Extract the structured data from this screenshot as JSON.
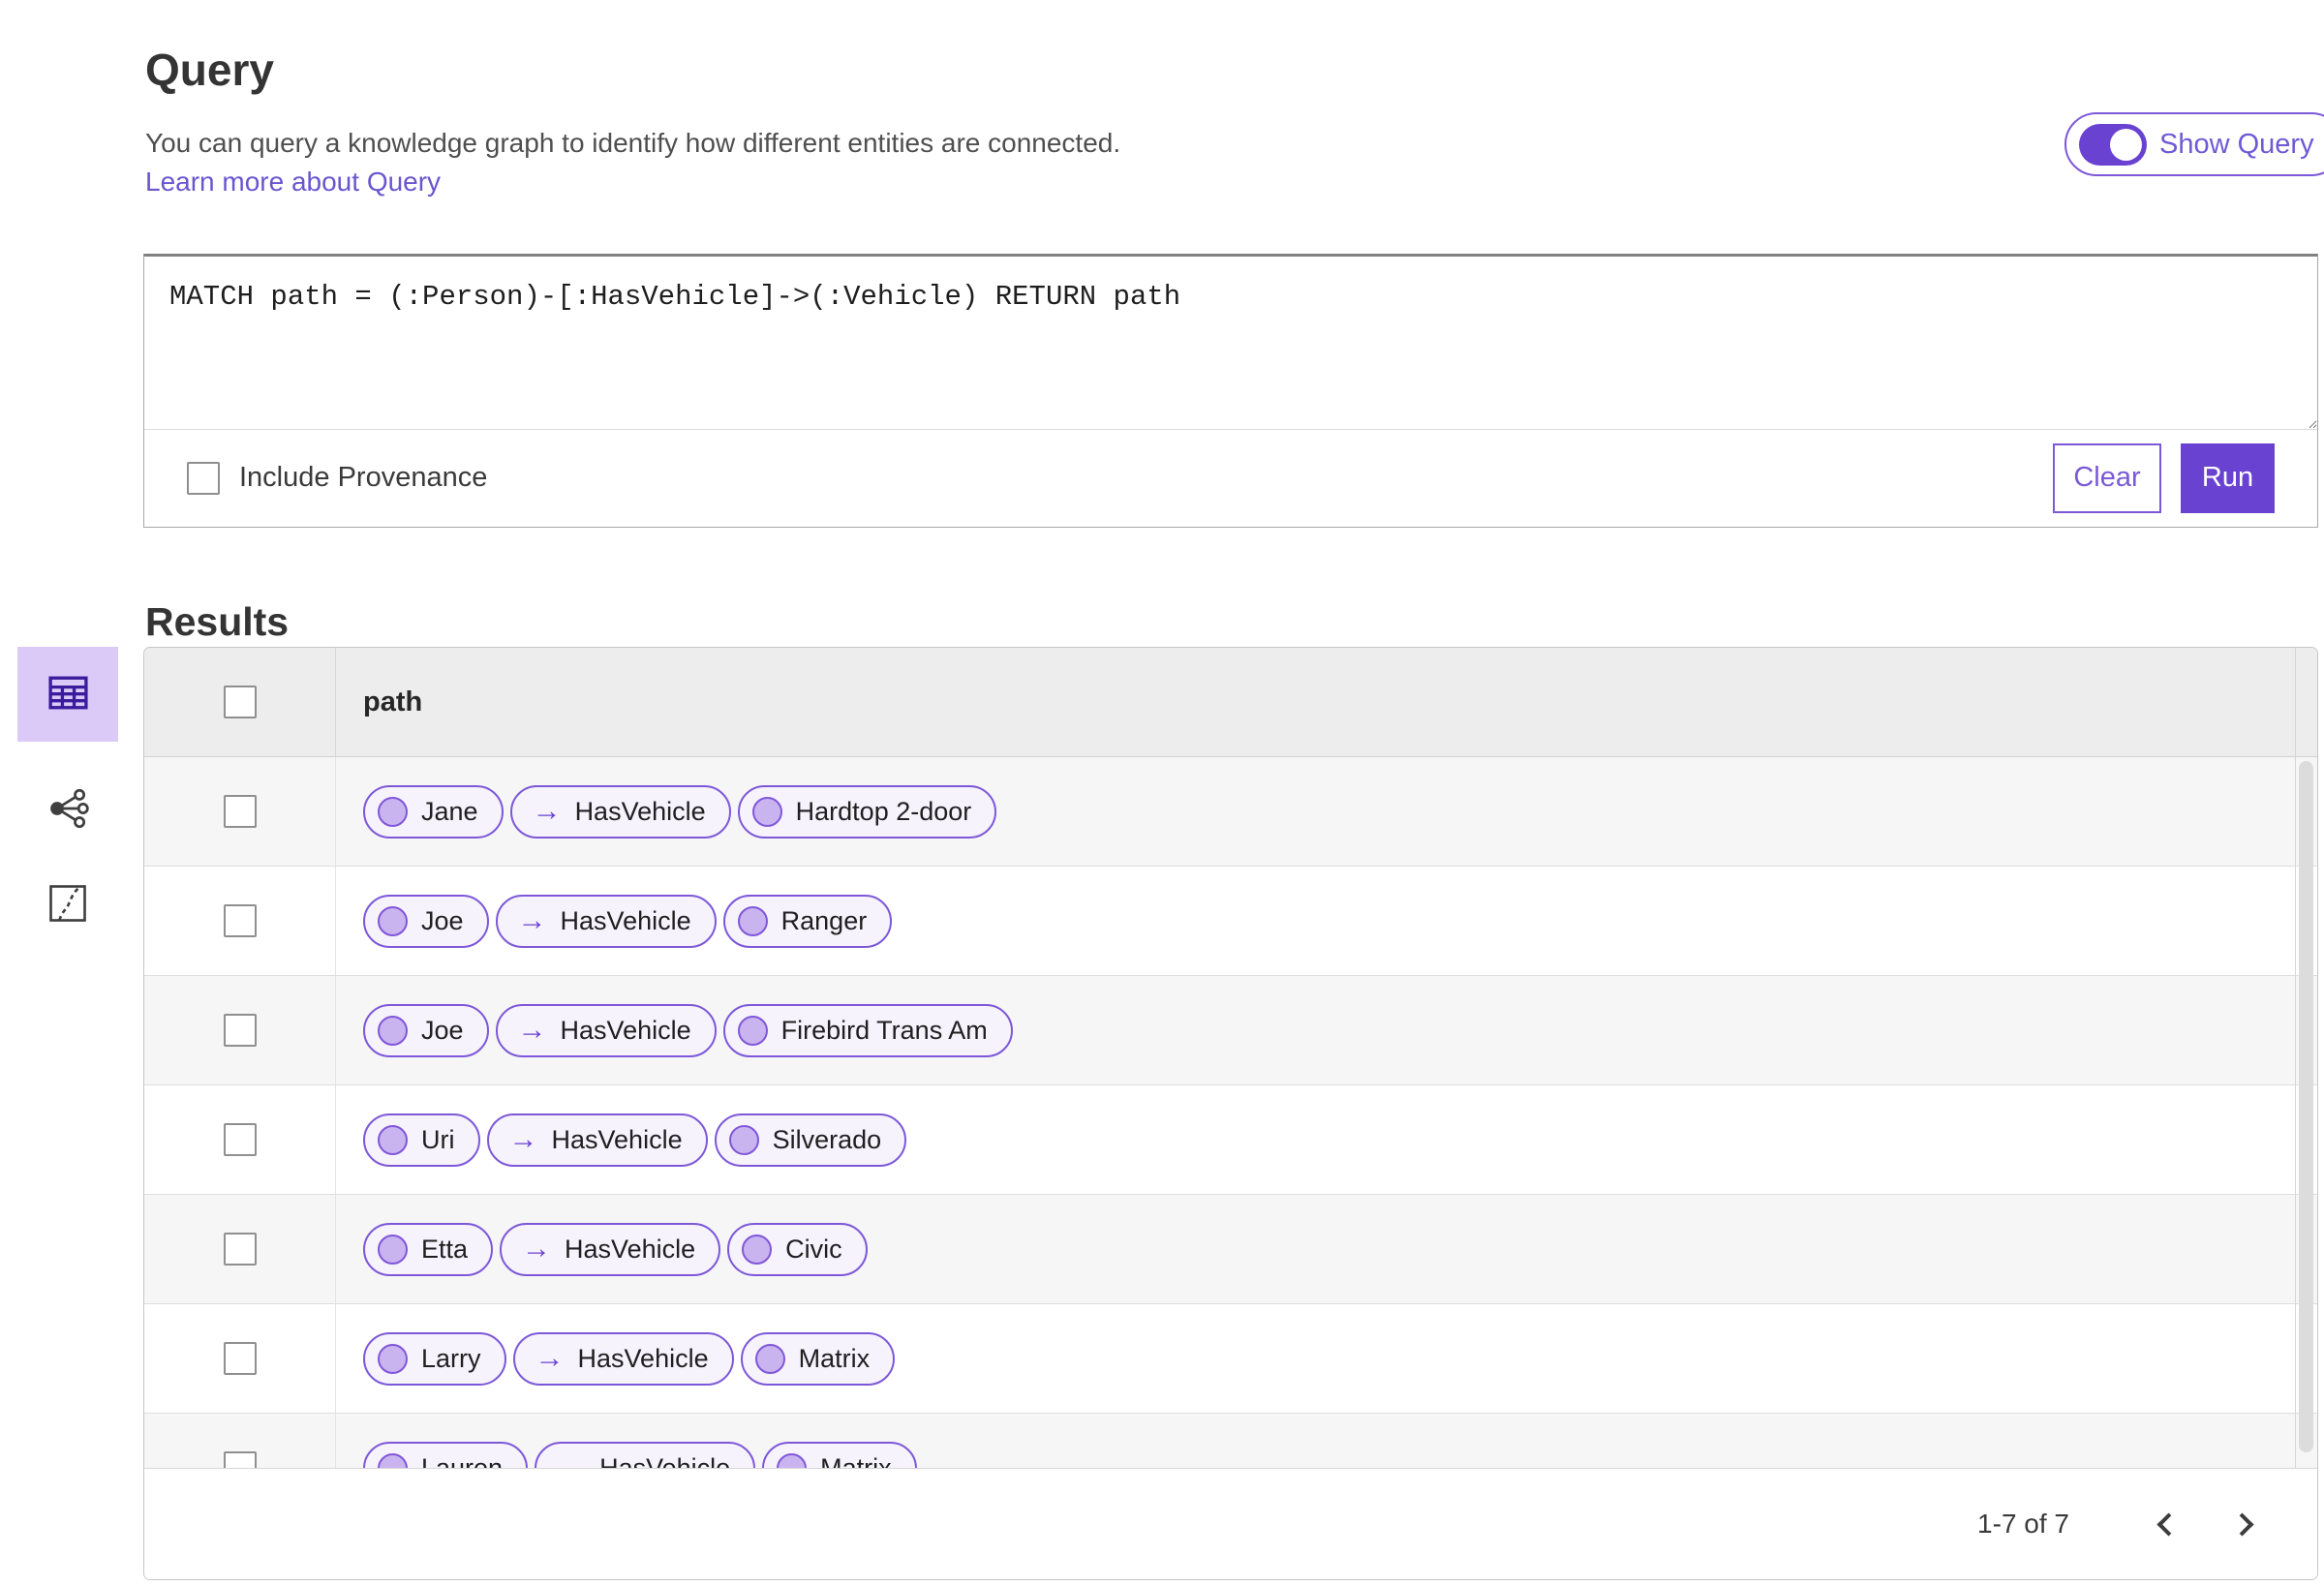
{
  "query_section": {
    "title": "Query",
    "description": "You can query a knowledge graph to identify how different entities are connected.",
    "learn_more_label": "Learn more about Query",
    "show_query_label": "Show Query",
    "show_query_on": true,
    "query_text": "MATCH path = (:Person)-[:HasVehicle]->(:Vehicle) RETURN path",
    "include_provenance_label": "Include Provenance",
    "include_provenance_checked": false,
    "clear_label": "Clear",
    "run_label": "Run"
  },
  "results_section": {
    "title": "Results",
    "view_switcher": [
      {
        "name": "table-view",
        "icon": "table-icon",
        "selected": true
      },
      {
        "name": "link-chart-view",
        "icon": "link-chart-icon",
        "selected": false
      },
      {
        "name": "map-view",
        "icon": "map-icon",
        "selected": false
      }
    ],
    "table": {
      "columns": [
        "path"
      ],
      "rows": [
        {
          "selected": false,
          "path": [
            {
              "type": "node",
              "label": "Jane"
            },
            {
              "type": "relationship",
              "label": "HasVehicle"
            },
            {
              "type": "node",
              "label": "Hardtop 2-door"
            }
          ]
        },
        {
          "selected": false,
          "path": [
            {
              "type": "node",
              "label": "Joe"
            },
            {
              "type": "relationship",
              "label": "HasVehicle"
            },
            {
              "type": "node",
              "label": "Ranger"
            }
          ]
        },
        {
          "selected": false,
          "path": [
            {
              "type": "node",
              "label": "Joe"
            },
            {
              "type": "relationship",
              "label": "HasVehicle"
            },
            {
              "type": "node",
              "label": "Firebird Trans Am"
            }
          ]
        },
        {
          "selected": false,
          "path": [
            {
              "type": "node",
              "label": "Uri"
            },
            {
              "type": "relationship",
              "label": "HasVehicle"
            },
            {
              "type": "node",
              "label": "Silverado"
            }
          ]
        },
        {
          "selected": false,
          "path": [
            {
              "type": "node",
              "label": "Etta"
            },
            {
              "type": "relationship",
              "label": "HasVehicle"
            },
            {
              "type": "node",
              "label": "Civic"
            }
          ]
        },
        {
          "selected": false,
          "path": [
            {
              "type": "node",
              "label": "Larry"
            },
            {
              "type": "relationship",
              "label": "HasVehicle"
            },
            {
              "type": "node",
              "label": "Matrix"
            }
          ]
        },
        {
          "selected": false,
          "path": [
            {
              "type": "node",
              "label": "Lauren"
            },
            {
              "type": "relationship",
              "label": "HasVehicle"
            },
            {
              "type": "node",
              "label": "Matrix"
            }
          ]
        }
      ]
    },
    "pagination": {
      "range_label": "1-7 of 7"
    }
  },
  "colors": {
    "accent": "#6a42d2",
    "accent_border": "#7d58d8",
    "link": "#6a55cf",
    "pill_bg": "#f6f3fd",
    "node_fill": "#c9b4f0",
    "node_border": "#8157d9",
    "tile_bg": "#dbc9f8",
    "tile_icon": "#3a1c9c",
    "header_bg": "#ededed",
    "row_alt": "#f6f6f6"
  }
}
